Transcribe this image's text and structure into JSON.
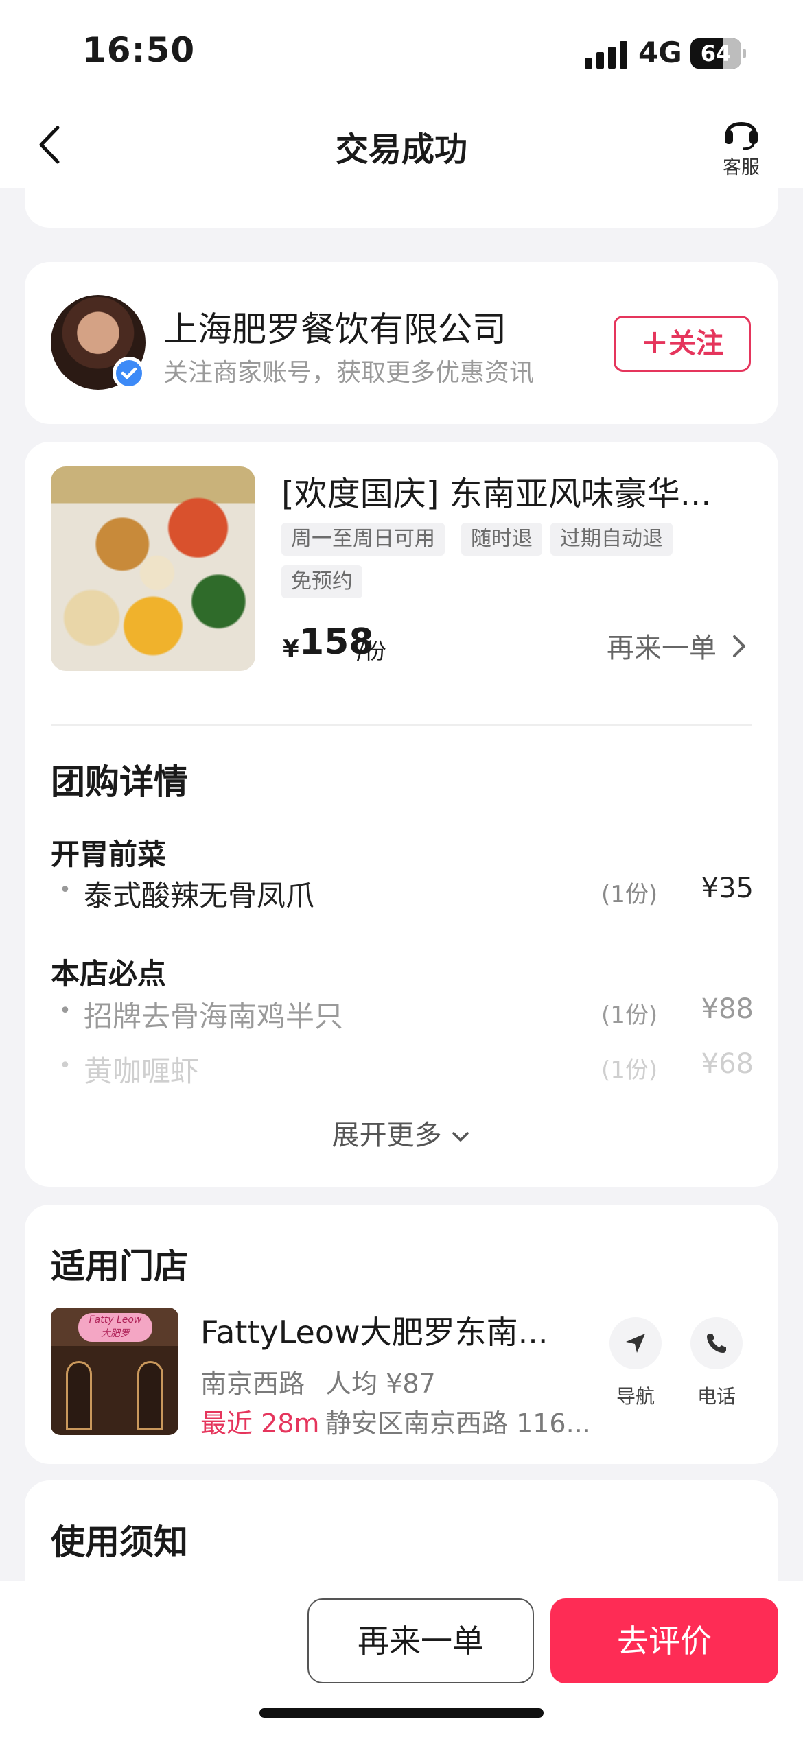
{
  "status_bar": {
    "time": "16:50",
    "network": "4G",
    "battery": "64"
  },
  "nav": {
    "title": "交易成功",
    "service_label": "客服"
  },
  "merchant": {
    "name": "上海肥罗餐饮有限公司",
    "subtitle": "关注商家账号，获取更多优惠资讯",
    "follow_label": "＋关注"
  },
  "deal": {
    "title": "[欢度国庆] 东南亚风味豪华...",
    "tags": [
      "周一至周日可用",
      "随时退",
      "过期自动退",
      "免预约"
    ],
    "price_symbol": "¥",
    "price": "158",
    "unit": "/份",
    "reorder_label": "再来一单"
  },
  "details": {
    "title": "团购详情",
    "groups": [
      {
        "name": "开胃前菜",
        "items": [
          {
            "name": "泰式酸辣无骨凤爪",
            "qty": "(1份)",
            "price": "¥35"
          }
        ]
      },
      {
        "name": "本店必点",
        "items": [
          {
            "name": "招牌去骨海南鸡半只",
            "qty": "(1份)",
            "price": "¥88"
          },
          {
            "name": "黄咖喱虾",
            "qty": "(1份)",
            "price": "¥68"
          }
        ]
      }
    ],
    "expand_label": "展开更多"
  },
  "store": {
    "title": "适用门店",
    "name": "FattyLeow大肥罗东南...",
    "area": "南京西路",
    "avg_price": "人均 ¥87",
    "distance": "最近 28m",
    "address": "静安区南京西路 116...",
    "nav_label": "导航",
    "phone_label": "电话",
    "sign_text": "Fatty Leow",
    "sign_sub": "大肥罗"
  },
  "notice": {
    "title": "使用须知"
  },
  "bottom": {
    "again_label": "再来一单",
    "review_label": "去评价"
  },
  "colors": {
    "accent": "#fe2c55",
    "follow": "#e5355c",
    "verified": "#3d8af7"
  }
}
